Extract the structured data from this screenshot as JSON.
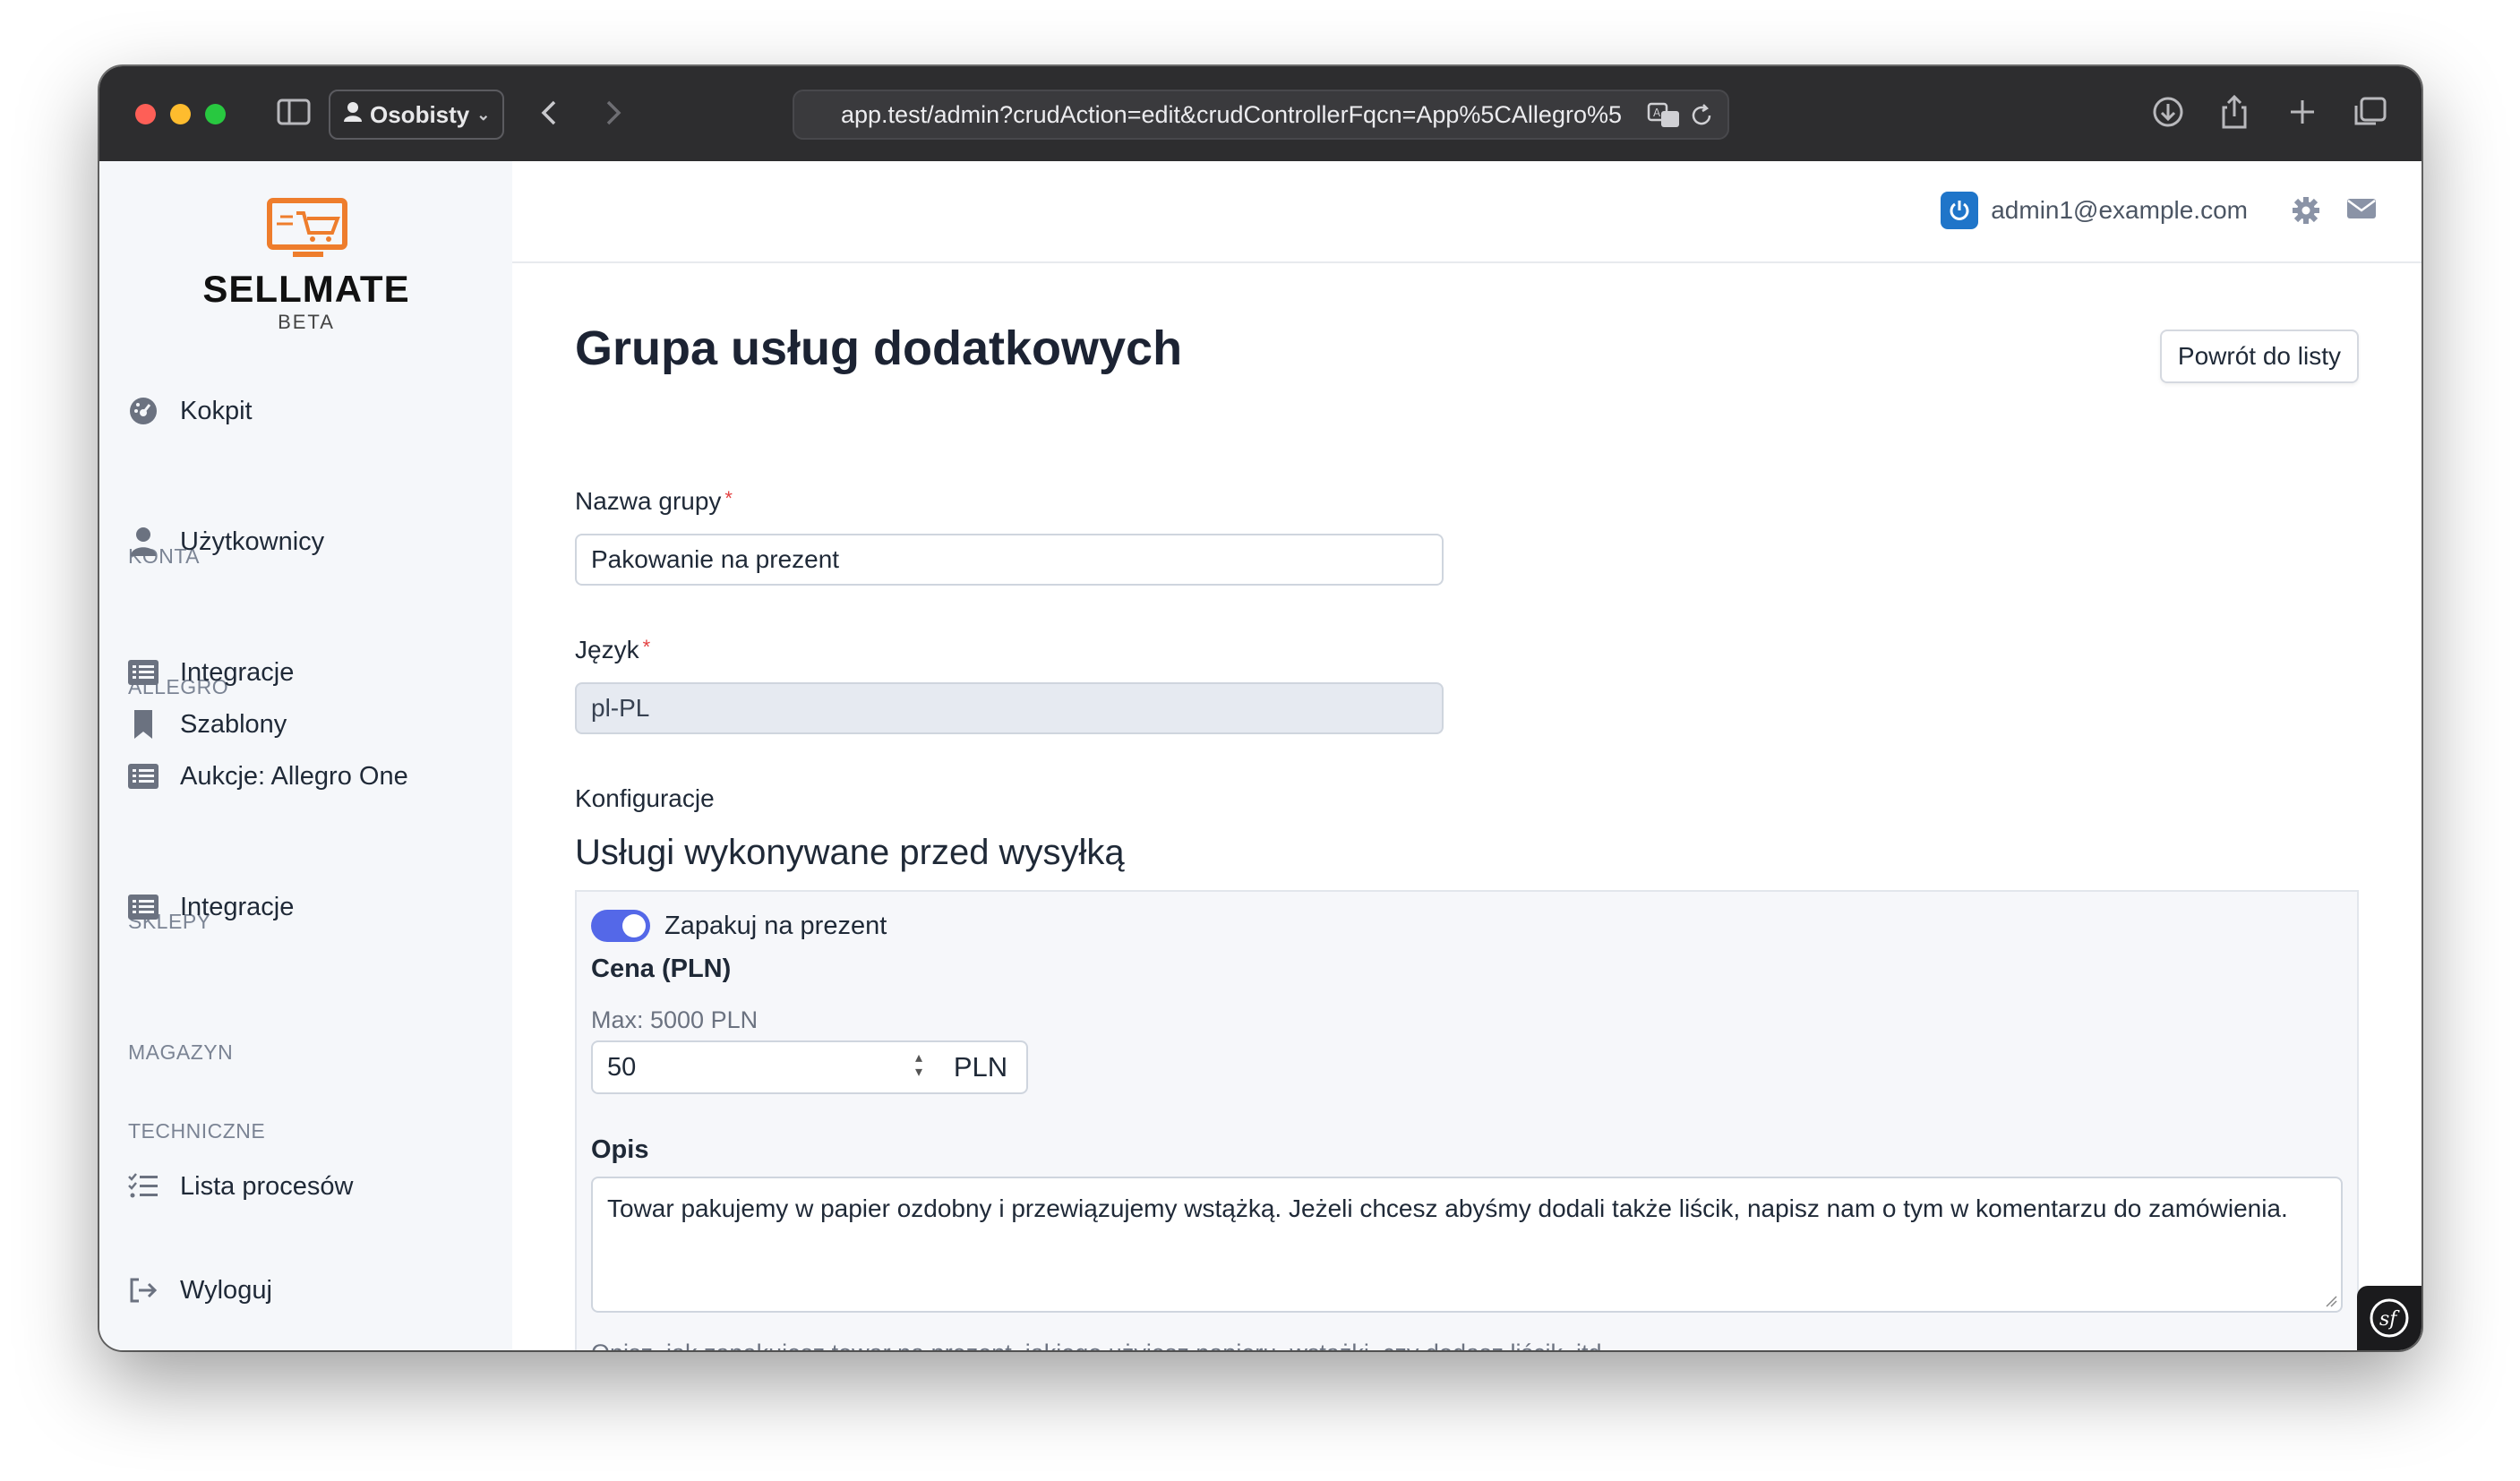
{
  "browser": {
    "profile_label": "Osobisty",
    "url": "app.test/admin?crudAction=edit&crudControllerFqcn=App%5CAllegro%5"
  },
  "sidebar": {
    "logo": {
      "word": "SELLMATE",
      "sub": "BETA"
    },
    "items": [
      {
        "label": "Kokpit",
        "icon": "dashboard-icon"
      },
      {
        "section": "KONTA"
      },
      {
        "label": "Użytkownicy",
        "icon": "user-icon"
      },
      {
        "section": "ALLEGRO"
      },
      {
        "label": "Integracje",
        "icon": "list-icon"
      },
      {
        "label": "Szablony",
        "icon": "bookmark-icon"
      },
      {
        "label": "Aukcje: Allegro One",
        "icon": "list-icon"
      },
      {
        "section": "SKLEPY"
      },
      {
        "label": "Integracje",
        "icon": "list-icon"
      },
      {
        "section": "MAGAZYN"
      },
      {
        "section": "TECHNICZNE"
      },
      {
        "label": "Lista procesów",
        "icon": "tasks-icon"
      },
      {
        "label": "Wyloguj",
        "icon": "logout-icon"
      }
    ]
  },
  "header": {
    "user_email": "admin1@example.com"
  },
  "page": {
    "title": "Grupa usług dodatkowych",
    "back_button": "Powrót do listy",
    "fields": {
      "group_name": {
        "label": "Nazwa grupy",
        "required_mark": "*",
        "value": "Pakowanie na prezent"
      },
      "language": {
        "label": "Język",
        "required_mark": "*",
        "value": "pl-PL"
      }
    },
    "config_label": "Konfiguracje",
    "section_title": "Usługi wykonywane przed wysyłką",
    "service": {
      "enabled": true,
      "toggle_label": "Zapakuj na prezent",
      "price_label": "Cena (PLN)",
      "price_help": "Max: 5000 PLN",
      "price_value": "50",
      "currency": "PLN",
      "description_label": "Opis",
      "description_value": "Towar pakujemy w papier ozdobny i przewiązujemy wstążką. Jeżeli chcesz abyśmy dodali także liścik, napisz nam o tym w komentarzu do zamówienia.",
      "description_help": "Opisz, jak zapakujesz towar na prezent, jakiego użyjesz papieru, wstążki, czy dodasz liścik, itd."
    }
  },
  "colors": {
    "accent": "#5468e8",
    "sidebar_bg": "#f5f7fa",
    "titlebar_bg": "#2d2d2f"
  }
}
